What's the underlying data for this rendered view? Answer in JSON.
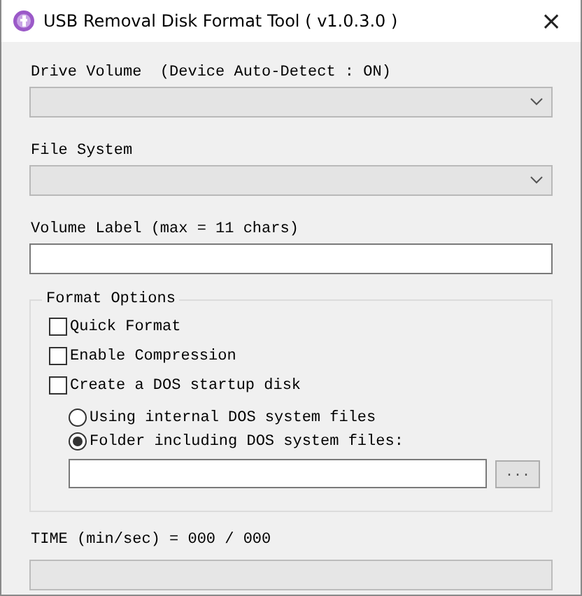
{
  "window": {
    "title": "USB Removal Disk Format Tool ( v1.0.3.0 )",
    "close": "×"
  },
  "drive_volume": {
    "label": "Drive Volume  (Device Auto-Detect : ON)",
    "disabled": true
  },
  "file_system": {
    "label": "File System",
    "disabled": true
  },
  "volume_label": {
    "label": "Volume Label (max = 11 chars)"
  },
  "format_options": {
    "title": "Format Options",
    "checkboxes": [
      {
        "label": "Quick Format",
        "checked": false
      },
      {
        "label": "Enable Compression",
        "checked": false
      },
      {
        "label": "Create a DOS startup disk",
        "checked": false
      }
    ],
    "radios": [
      {
        "label": "Using internal DOS system files",
        "selected": false
      },
      {
        "label": "Folder including DOS system files:",
        "selected": true
      }
    ],
    "browse_button": "..."
  },
  "time": {
    "label": "TIME (min/sec) = 000 / 000"
  }
}
